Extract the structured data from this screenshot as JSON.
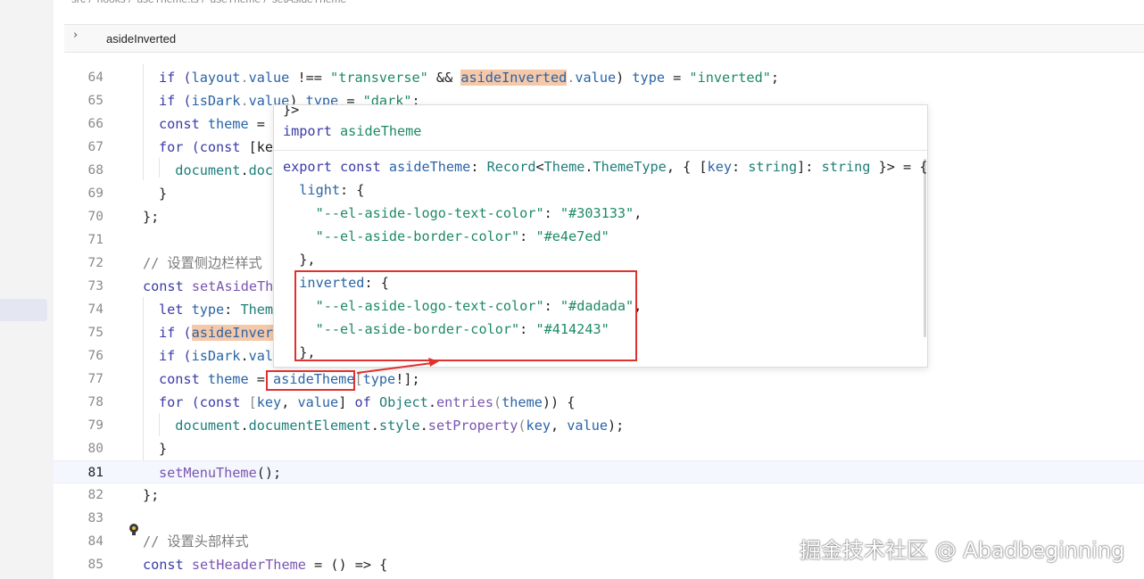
{
  "breadcrumb": [
    "src",
    "hooks",
    "useTheme.ts",
    "useTheme",
    "setAsideTheme"
  ],
  "find": {
    "chevron": "›",
    "query": "asideInverted"
  },
  "current_line": "81",
  "lines": [
    {
      "n": "64",
      "tokens": [
        [
          "if (",
          "k"
        ],
        [
          "layout",
          "v"
        ],
        [
          ".",
          "p"
        ],
        [
          "value",
          "v"
        ],
        [
          " !== ",
          ""
        ],
        [
          "\"transverse\"",
          "s"
        ],
        [
          " && ",
          ""
        ],
        [
          "asideInverted",
          "vhl"
        ],
        [
          ".",
          "p"
        ],
        [
          "value",
          "v"
        ],
        [
          ") ",
          ""
        ],
        [
          "type",
          "v"
        ],
        [
          " = ",
          ""
        ],
        [
          "\"inverted\"",
          "s"
        ],
        [
          ";",
          ""
        ]
      ]
    },
    {
      "n": "65",
      "tokens": [
        [
          "if (",
          "k"
        ],
        [
          "isDark",
          "v"
        ],
        [
          ".",
          "p"
        ],
        [
          "value",
          "v"
        ],
        [
          ") ",
          ""
        ],
        [
          "type",
          "v"
        ],
        [
          " = ",
          ""
        ],
        [
          "\"dark\"",
          "s"
        ],
        [
          ";",
          ""
        ]
      ]
    },
    {
      "n": "66",
      "tokens": [
        [
          "const ",
          "k"
        ],
        [
          "theme",
          "v"
        ],
        [
          " =",
          ""
        ]
      ]
    },
    {
      "n": "67",
      "tokens": [
        [
          "for (",
          "k"
        ],
        [
          "const ",
          "k"
        ],
        [
          "[ke",
          ""
        ]
      ]
    },
    {
      "n": "68",
      "tokens": [
        [
          "  ",
          ""
        ],
        [
          "document",
          "t"
        ],
        [
          ".",
          ""
        ],
        [
          "doc",
          "t"
        ]
      ]
    },
    {
      "n": "69",
      "tokens": [
        [
          "}",
          ""
        ]
      ]
    },
    {
      "n": "70",
      "tokens": [
        [
          "};",
          ""
        ]
      ]
    },
    {
      "n": "71",
      "tokens": []
    },
    {
      "n": "72",
      "tokens": [
        [
          "// 设置侧边栏样式",
          "c"
        ]
      ]
    },
    {
      "n": "73",
      "tokens": [
        [
          "const ",
          "k"
        ],
        [
          "setAsideTh",
          "f"
        ]
      ]
    },
    {
      "n": "74",
      "tokens": [
        [
          "let ",
          "k"
        ],
        [
          "type",
          "v"
        ],
        [
          ": ",
          ""
        ],
        [
          "Them",
          "t"
        ]
      ]
    },
    {
      "n": "75",
      "tokens": [
        [
          "if (",
          "k"
        ],
        [
          "asideInver",
          "vhl2"
        ]
      ]
    },
    {
      "n": "76",
      "tokens": [
        [
          "if (",
          "k"
        ],
        [
          "isDark",
          "v"
        ],
        [
          ".",
          ""
        ],
        [
          "val",
          "v"
        ]
      ]
    },
    {
      "n": "77",
      "tokens": [
        [
          "const ",
          "k"
        ],
        [
          "theme",
          "v"
        ],
        [
          " = ",
          ""
        ],
        [
          "asideTheme",
          "v"
        ],
        [
          "[",
          "p"
        ],
        [
          "type",
          "v"
        ],
        [
          "!];",
          ""
        ]
      ]
    },
    {
      "n": "78",
      "tokens": [
        [
          "for (",
          "k"
        ],
        [
          "const ",
          "k"
        ],
        [
          "[",
          "p"
        ],
        [
          "key",
          "v"
        ],
        [
          ", ",
          ""
        ],
        [
          "value",
          "v"
        ],
        [
          "] ",
          ""
        ],
        [
          "of ",
          "k"
        ],
        [
          "Object",
          "t"
        ],
        [
          ".",
          ""
        ],
        [
          "entries",
          "f"
        ],
        [
          "(",
          "p"
        ],
        [
          "theme",
          "v"
        ],
        [
          ")) {",
          ""
        ]
      ]
    },
    {
      "n": "79",
      "tokens": [
        [
          "  ",
          ""
        ],
        [
          "document",
          "t"
        ],
        [
          ".",
          ""
        ],
        [
          "documentElement",
          "t"
        ],
        [
          ".",
          ""
        ],
        [
          "style",
          "t"
        ],
        [
          ".",
          ""
        ],
        [
          "setProperty",
          "f"
        ],
        [
          "(",
          "p"
        ],
        [
          "key",
          "v"
        ],
        [
          ", ",
          ""
        ],
        [
          "value",
          "v"
        ],
        [
          ");",
          ""
        ]
      ]
    },
    {
      "n": "80",
      "tokens": [
        [
          "}",
          ""
        ]
      ]
    },
    {
      "n": "81",
      "tokens": [
        [
          "setMenuTheme",
          "f"
        ],
        [
          "();",
          ""
        ]
      ]
    },
    {
      "n": "82",
      "tokens": [
        [
          "};",
          ""
        ]
      ]
    },
    {
      "n": "83",
      "tokens": []
    },
    {
      "n": "84",
      "tokens": [
        [
          "// 设置头部样式",
          "c"
        ]
      ]
    },
    {
      "n": "85",
      "tokens": [
        [
          "const ",
          "k"
        ],
        [
          "setHeaderTheme",
          "f"
        ],
        [
          " = () => {",
          ""
        ]
      ]
    }
  ],
  "popup": {
    "top_fragment": "}>",
    "import_line": [
      [
        "import ",
        "k"
      ],
      [
        "asideTheme",
        "s"
      ]
    ],
    "code": [
      [
        [
          "export ",
          "k"
        ],
        [
          "const ",
          "k"
        ],
        [
          "asideTheme",
          "v"
        ],
        [
          ": ",
          ""
        ],
        [
          "Record",
          "t"
        ],
        [
          "<",
          ""
        ],
        [
          "Theme",
          "t"
        ],
        [
          ".",
          ""
        ],
        [
          "ThemeType",
          "t"
        ],
        [
          ", { [",
          ""
        ],
        [
          "key",
          "v"
        ],
        [
          ": ",
          ""
        ],
        [
          "string",
          "t"
        ],
        [
          "]: ",
          ""
        ],
        [
          "string",
          "t"
        ],
        [
          " }> = {",
          ""
        ]
      ],
      [
        [
          "  light",
          "v"
        ],
        [
          ": {",
          ""
        ]
      ],
      [
        [
          "    ",
          ""
        ],
        [
          "\"--el-aside-logo-text-color\"",
          "s"
        ],
        [
          ": ",
          ""
        ],
        [
          "\"#303133\"",
          "s"
        ],
        [
          ",",
          ""
        ]
      ],
      [
        [
          "    ",
          ""
        ],
        [
          "\"--el-aside-border-color\"",
          "s"
        ],
        [
          ": ",
          ""
        ],
        [
          "\"#e4e7ed\"",
          "s"
        ]
      ],
      [
        [
          "  },",
          ""
        ]
      ],
      [
        [
          "  inverted",
          "v"
        ],
        [
          ": {",
          ""
        ]
      ],
      [
        [
          "    ",
          ""
        ],
        [
          "\"--el-aside-logo-text-color\"",
          "s"
        ],
        [
          ": ",
          ""
        ],
        [
          "\"#dadada\"",
          "s"
        ],
        [
          ",",
          ""
        ]
      ],
      [
        [
          "    ",
          ""
        ],
        [
          "\"--el-aside-border-color\"",
          "s"
        ],
        [
          ": ",
          ""
        ],
        [
          "\"#414243\"",
          "s"
        ]
      ],
      [
        [
          "  },",
          ""
        ]
      ]
    ]
  },
  "watermark": "掘金技术社区 @ Abadbeginning",
  "colors": {
    "annotation_red": "#e0312e",
    "highlight": "#f4c8a8",
    "current_line_bg": "#f5f7ff"
  }
}
